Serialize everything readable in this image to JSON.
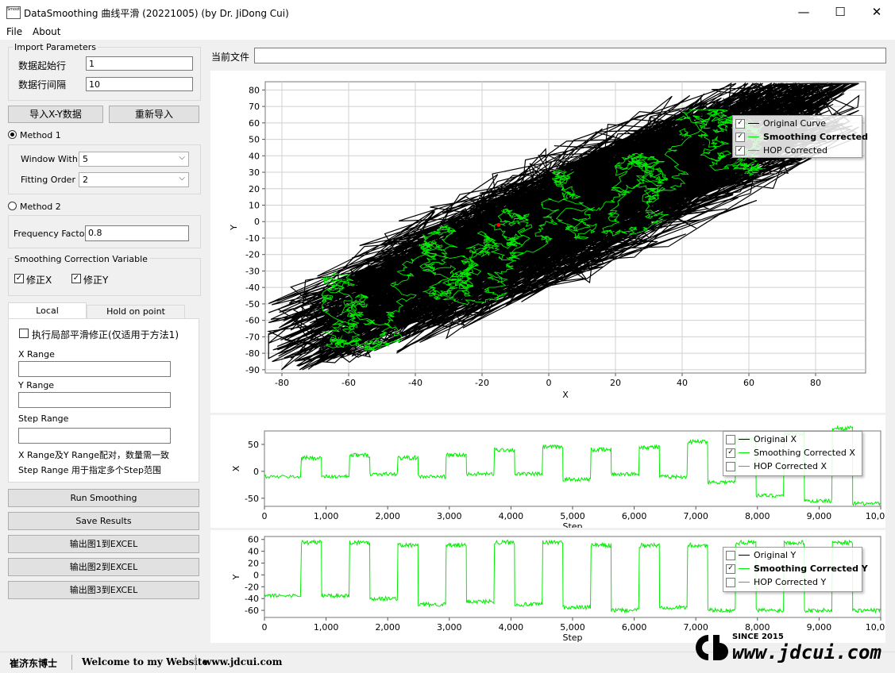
{
  "window": {
    "title": "DataSmoothing 曲线平滑 (20221005) (by Dr. JiDong Cui)",
    "icon_label": "Smooth",
    "minimize": "—",
    "maximize": "☐",
    "close": "✕"
  },
  "menu": {
    "file": "File",
    "about": "About"
  },
  "import": {
    "group_title": "Import Parameters",
    "start_row_label": "数据起始行",
    "start_row_value": "1",
    "row_interval_label": "数据行间隔",
    "row_interval_value": "10"
  },
  "buttons": {
    "import_xy": "导入X-Y数据",
    "reimport": "重新导入",
    "run": "Run Smoothing",
    "save": "Save Results",
    "export1": "输出图1到EXCEL",
    "export2": "输出图2到EXCEL",
    "export3": "输出图3到EXCEL"
  },
  "method1": {
    "label": "Method 1",
    "selected": true,
    "window_label": "Window With",
    "window_value": "5",
    "order_label": "Fitting Order",
    "order_value": "2"
  },
  "method2": {
    "label": "Method 2",
    "selected": false,
    "freq_label": "Frequency Factor",
    "freq_value": "0.8"
  },
  "correction": {
    "group_title": "Smoothing Correction Variable",
    "fix_x": "修正X",
    "fix_y": "修正Y",
    "fix_x_checked": true,
    "fix_y_checked": true
  },
  "tabs": {
    "local": "Local Optimization",
    "hold": "Hold on point correction",
    "active": "local"
  },
  "local": {
    "exec_label": "执行局部平滑修正(仅适用于方法1)",
    "exec_checked": false,
    "x_range_label": "X Range",
    "x_range_value": "",
    "y_range_label": "Y Range",
    "y_range_value": "",
    "step_range_label": "Step Range",
    "step_range_value": "",
    "note1": "X Range及Y Range配对，数量需一致",
    "note2": "Step Range 用于指定多个Step范围"
  },
  "current_file": {
    "label": "当前文件",
    "value": ""
  },
  "colors": {
    "original": "#000000",
    "smoothing": "#00ee00",
    "hop": "#cc55cc",
    "marker": "#ff0000"
  },
  "chart1": {
    "type": "line",
    "xlabel": "X",
    "ylabel": "Y",
    "xlim": [
      -85,
      95
    ],
    "ylim": [
      -92,
      85
    ],
    "xticks": [
      "-80",
      "-60",
      "-40",
      "-20",
      "0",
      "20",
      "40",
      "60",
      "80"
    ],
    "yticks": [
      "80",
      "70",
      "60",
      "50",
      "40",
      "30",
      "20",
      "10",
      "0",
      "-10",
      "-20",
      "-30",
      "-40",
      "-50",
      "-60",
      "-70",
      "-80",
      "-90"
    ],
    "legend": [
      {
        "name": "Original Curve",
        "checked": true,
        "bold": false
      },
      {
        "name": "Smoothing Corrected",
        "checked": true,
        "bold": true
      },
      {
        "name": "HOP Corrected",
        "checked": true,
        "bold": false
      }
    ]
  },
  "chart2": {
    "type": "line",
    "xlabel": "Step",
    "ylabel": "X",
    "xlim": [
      0,
      10000
    ],
    "ylim": [
      -65,
      75
    ],
    "xticks": [
      "0",
      "1,000",
      "2,000",
      "3,000",
      "4,000",
      "5,000",
      "6,000",
      "7,000",
      "8,000",
      "9,000",
      "10,000"
    ],
    "yticks": [
      "50",
      "0",
      "-50"
    ],
    "legend": [
      {
        "name": "Original X",
        "checked": false,
        "bold": false
      },
      {
        "name": "Smoothing Corrected X",
        "checked": true,
        "bold": false
      },
      {
        "name": "HOP Corrected X",
        "checked": false,
        "bold": false
      }
    ]
  },
  "chart3": {
    "type": "line",
    "xlabel": "Step",
    "ylabel": "Y",
    "xlim": [
      0,
      10000
    ],
    "ylim": [
      -72,
      65
    ],
    "xticks": [
      "0",
      "1,000",
      "2,000",
      "3,000",
      "4,000",
      "5,000",
      "6,000",
      "7,000",
      "8,000",
      "9,000",
      "10,000"
    ],
    "yticks": [
      "60",
      "40",
      "20",
      "0",
      "-20",
      "-40",
      "-60"
    ],
    "legend": [
      {
        "name": "Original Y",
        "checked": false,
        "bold": false
      },
      {
        "name": "Smoothing Corrected Y",
        "checked": true,
        "bold": true
      },
      {
        "name": "HOP Corrected Y",
        "checked": false,
        "bold": false
      }
    ]
  },
  "chart_data": [
    {
      "type": "scatter",
      "title": "",
      "xlabel": "X",
      "ylabel": "Y",
      "xlim": [
        -85,
        95
      ],
      "ylim": [
        -92,
        85
      ],
      "grid": true,
      "legend_position": "top-right",
      "series": [
        {
          "name": "Original Curve",
          "points": [
            [
              -85,
              -88
            ],
            [
              -60,
              -72
            ],
            [
              -40,
              -50
            ],
            [
              -20,
              -15
            ],
            [
              0,
              -5
            ],
            [
              20,
              15
            ],
            [
              40,
              40
            ],
            [
              60,
              62
            ],
            [
              90,
              75
            ]
          ]
        },
        {
          "name": "Smoothing Corrected",
          "points": [
            [
              -65,
              -70
            ],
            [
              -40,
              -55
            ],
            [
              -20,
              -10
            ],
            [
              0,
              0
            ],
            [
              20,
              20
            ],
            [
              40,
              45
            ],
            [
              55,
              55
            ],
            [
              70,
              55
            ]
          ]
        }
      ]
    },
    {
      "type": "line",
      "title": "",
      "xlabel": "Step",
      "ylabel": "X",
      "xlim": [
        0,
        10000
      ],
      "ylim": [
        -65,
        75
      ],
      "grid": false,
      "legend_position": "top-right",
      "series": [
        {
          "name": "Smoothing Corrected X",
          "square_wave": true,
          "low": [
            -10,
            -5,
            -10,
            -5,
            -5,
            -15,
            -5,
            -10,
            -20,
            -45,
            -55,
            -60
          ],
          "high": [
            25,
            30,
            25,
            30,
            40,
            45,
            40,
            45,
            55,
            60,
            70,
            80
          ]
        }
      ]
    },
    {
      "type": "line",
      "title": "",
      "xlabel": "Step",
      "ylabel": "Y",
      "xlim": [
        0,
        10000
      ],
      "ylim": [
        -72,
        65
      ],
      "grid": false,
      "legend_position": "top-right",
      "series": [
        {
          "name": "Smoothing Corrected Y",
          "square_wave": true,
          "low": [
            -35,
            -40,
            -50,
            -45,
            -50,
            -55,
            -60,
            -55,
            -60,
            -60,
            -60,
            -60
          ],
          "high": [
            55,
            55,
            50,
            50,
            55,
            55,
            50,
            50,
            50,
            55,
            55,
            55
          ]
        }
      ]
    }
  ],
  "status": {
    "author": "崔济东博士",
    "welcome": "Welcome to my Website",
    "site": "www.jdcui.com",
    "logo_text": "www.jdcui.com",
    "since": "SINCE 2015"
  }
}
